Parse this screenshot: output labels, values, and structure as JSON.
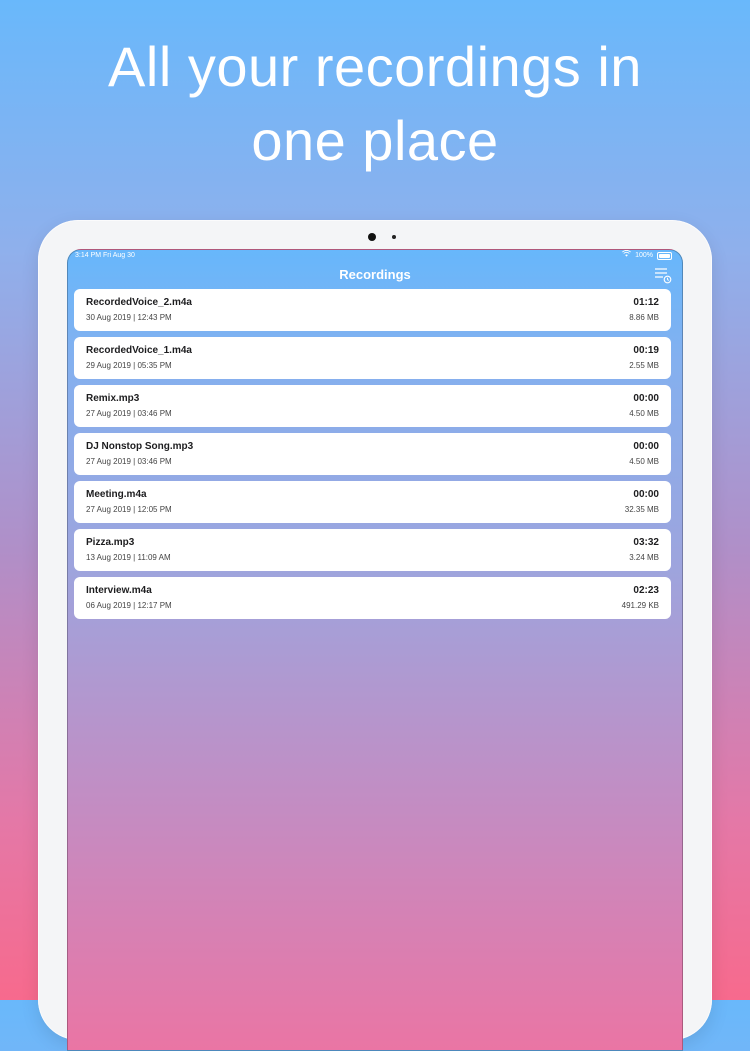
{
  "headline": {
    "line1": "All your recordings in",
    "line2": "one place"
  },
  "statusbar": {
    "time_date": "3:14 PM   Fri Aug 30",
    "battery": "100%",
    "icons": [
      "wifi-icon",
      "battery-icon"
    ]
  },
  "navbar": {
    "title": "Recordings",
    "right_icon": "sort-list-icon"
  },
  "recordings": [
    {
      "name": "RecordedVoice_2.m4a",
      "date": "30 Aug 2019 | 12:43 PM",
      "duration": "01:12",
      "size": "8.86 MB"
    },
    {
      "name": "RecordedVoice_1.m4a",
      "date": "29 Aug 2019 | 05:35 PM",
      "duration": "00:19",
      "size": "2.55 MB"
    },
    {
      "name": "Remix.mp3",
      "date": "27 Aug 2019 | 03:46 PM",
      "duration": "00:00",
      "size": "4.50 MB"
    },
    {
      "name": "DJ Nonstop Song.mp3",
      "date": "27 Aug 2019 | 03:46 PM",
      "duration": "00:00",
      "size": "4.50 MB"
    },
    {
      "name": "Meeting.m4a",
      "date": "27 Aug 2019 | 12:05 PM",
      "duration": "00:00",
      "size": "32.35 MB"
    },
    {
      "name": "Pizza.mp3",
      "date": "13 Aug 2019 | 11:09 AM",
      "duration": "03:32",
      "size": "3.24 MB"
    },
    {
      "name": "Interview.m4a",
      "date": "06 Aug 2019 | 12:17 PM",
      "duration": "02:23",
      "size": "491.29 KB"
    }
  ],
  "colors": {
    "background_top": "#69b8fb",
    "background_bottom": "#f76a8d",
    "card": "#ffffff",
    "text": "#1d1d1f"
  }
}
